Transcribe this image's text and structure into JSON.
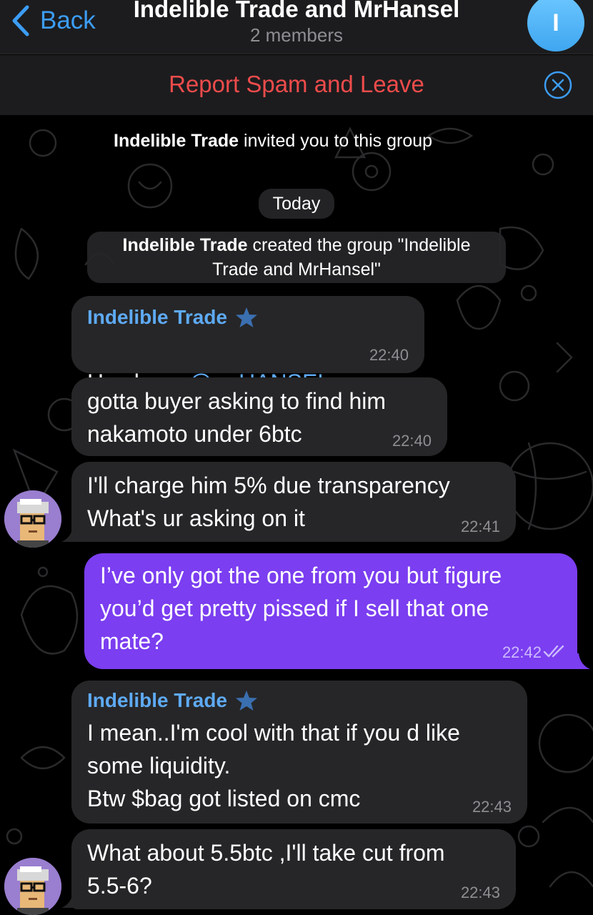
{
  "header": {
    "back_label": "Back",
    "title": "Indelible Trade and MrHansel",
    "subtitle": "2 members",
    "avatar_letter": "I"
  },
  "spam_bar": {
    "text": "Report Spam and Leave"
  },
  "service_messages": {
    "invite": {
      "actor": "Indelible Trade",
      "text": "invited you to this group"
    },
    "date": "Today",
    "created": {
      "actor": "Indelible Trade",
      "line1": "created the group \"Indelible",
      "line2": "Trade and MrHansel\""
    }
  },
  "messages": [
    {
      "sender": "Indelible Trade",
      "text_prefix": "Hey boss ",
      "mention": "@mrHANSEL",
      "time": "22:40"
    },
    {
      "text": "gotta buyer asking to find him\nnakamoto under 6btc",
      "time": "22:40"
    },
    {
      "text": "I'll charge him 5% due transparency\nWhat's ur asking on it",
      "time": "22:41"
    },
    {
      "text": "I’ve only got the one from you but figure\nyou’d get pretty pissed if I sell that one\nmate?",
      "time": "22:42"
    },
    {
      "sender": "Indelible Trade",
      "text": "I mean..I'm cool with that if you d like\nsome liquidity.\nBtw $bag got listed on cmc",
      "time": "22:43"
    },
    {
      "text": "What about 5.5btc ,I'll take cut from\n5.5-6?",
      "time": "22:43"
    }
  ],
  "colors": {
    "accent": "#3c9df5",
    "outgoing_bubble": "#7b3ef0",
    "incoming_bubble": "#262628",
    "danger": "#ee4b4b"
  }
}
